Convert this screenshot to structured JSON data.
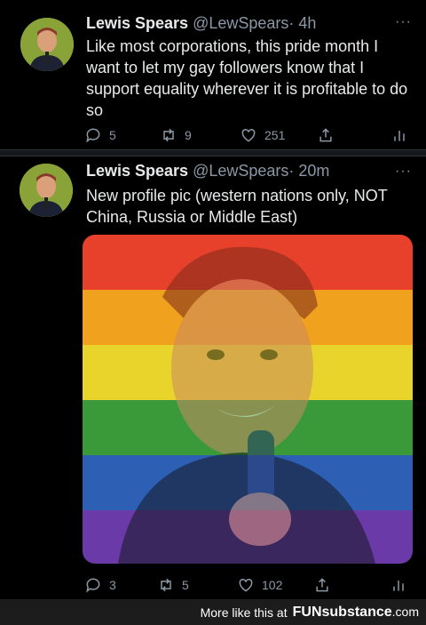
{
  "tweets": [
    {
      "name": "Lewis Spears",
      "handle": "@LewSpears",
      "time": "· 4h",
      "text": "Like most corporations, this pride month I want to let my gay followers know that I support equality wherever it is profitable to do so",
      "replies": "5",
      "retweets": "9",
      "likes": "251"
    },
    {
      "name": "Lewis Spears",
      "handle": "@LewSpears",
      "time": "· 20m",
      "text": "New profile pic (western nations only, NOT China, Russia or Middle East)",
      "replies": "3",
      "retweets": "5",
      "likes": "102"
    }
  ],
  "more_icon": "···",
  "footer": {
    "prefix": "More like this at",
    "brand": "FUNsubstance",
    "suffix": ".com"
  },
  "colors": {
    "rainbow": [
      "#e8412b",
      "#f0a11e",
      "#e8d42a",
      "#3a9a3a",
      "#2d5fb5",
      "#6a3aa8"
    ]
  },
  "icons": [
    "reply-icon",
    "retweet-icon",
    "like-icon",
    "share-icon",
    "analytics-icon"
  ]
}
